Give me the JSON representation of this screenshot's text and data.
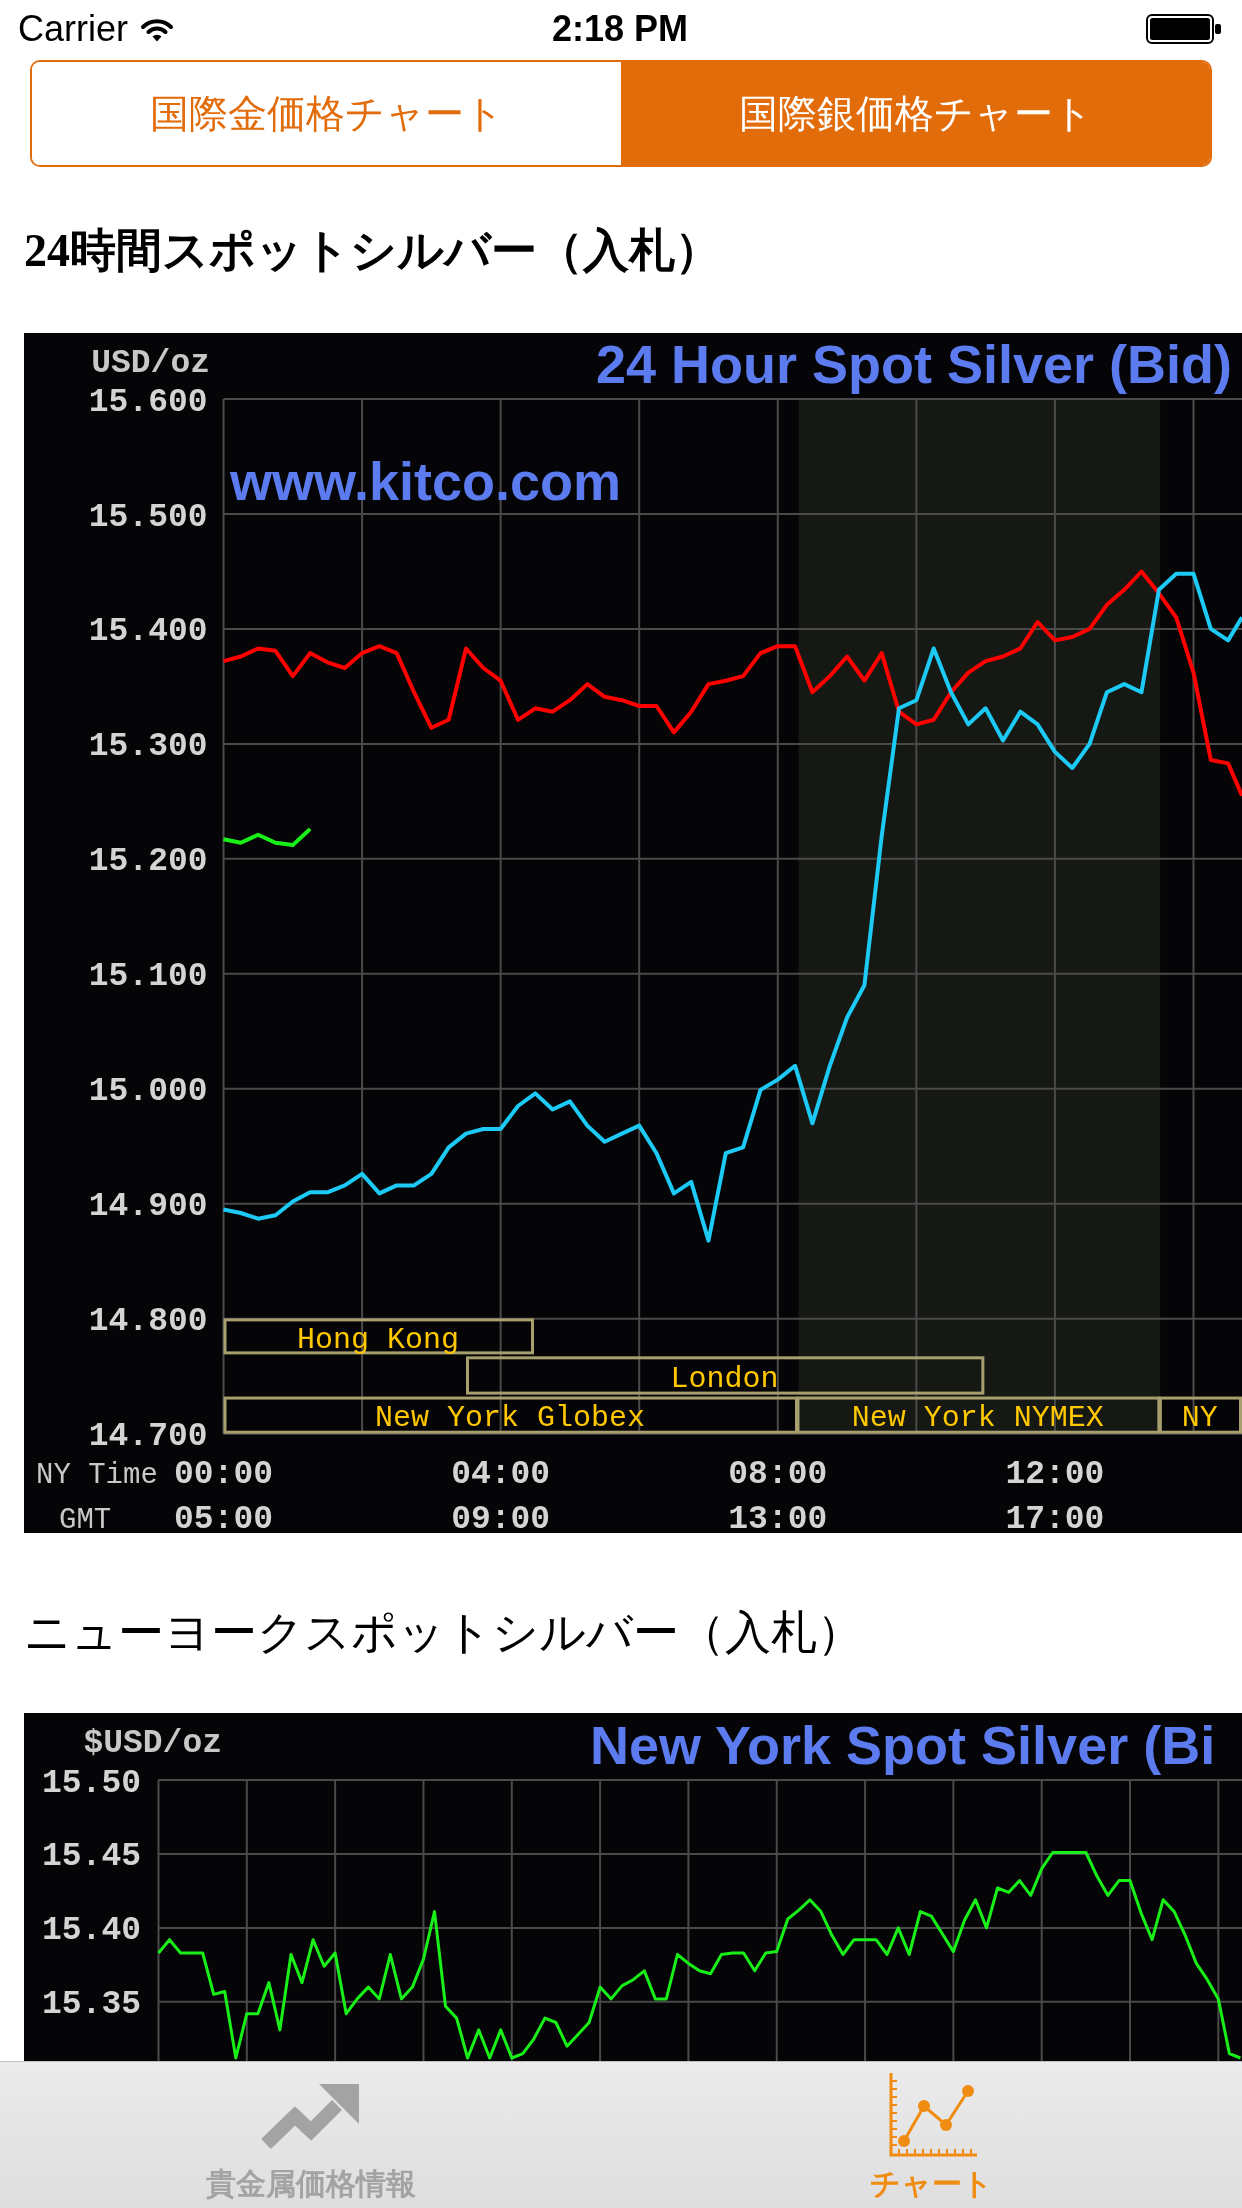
{
  "status_bar": {
    "carrier": "Carrier",
    "time": "2:18 PM"
  },
  "segmented_control": [
    {
      "label": "国際金価格チャート",
      "selected": false
    },
    {
      "label": "国際銀価格チャート",
      "selected": true
    }
  ],
  "sections": [
    {
      "heading": "24時間スポットシルバー（入札）",
      "chart": {
        "source": "www.kitco.com",
        "chart_data": {
          "type": "line",
          "title": "24 Hour Spot Silver (Bid)",
          "xlabel": "NY Time",
          "ylabel": "USD/oz",
          "x": [
            0,
            0.25,
            0.5,
            0.75,
            1,
            1.25,
            1.5,
            1.75,
            2,
            2.25,
            2.5,
            2.75,
            3,
            3.25,
            3.5,
            3.75,
            4,
            4.25,
            4.5,
            4.75,
            5,
            5.25,
            5.5,
            5.75,
            6,
            6.25,
            6.5,
            6.75,
            7,
            7.25,
            7.5,
            7.75,
            8,
            8.25,
            8.5,
            8.75,
            9,
            9.25,
            9.5,
            9.75,
            10,
            10.25,
            10.5,
            10.75,
            11,
            11.25,
            11.5,
            11.75,
            12,
            12.25,
            12.5,
            12.75,
            13,
            13.25,
            13.5,
            13.75,
            14,
            14.25,
            14.5,
            14.7
          ],
          "series": [
            {
              "color": "#ff0000",
              "values": [
                15.372,
                15.376,
                15.383,
                15.381,
                15.359,
                15.379,
                15.371,
                15.366,
                15.379,
                15.385,
                15.379,
                15.345,
                15.314,
                15.321,
                15.383,
                15.366,
                15.355,
                15.321,
                15.331,
                15.328,
                15.338,
                15.352,
                15.341,
                15.338,
                15.333,
                15.333,
                15.31,
                15.328,
                15.352,
                15.355,
                15.359,
                15.379,
                15.385,
                15.385,
                15.345,
                15.359,
                15.376,
                15.355,
                15.379,
                15.328,
                15.317,
                15.321,
                15.345,
                15.362,
                15.372,
                15.376,
                15.383,
                15.406,
                15.39,
                15.393,
                15.4,
                15.421,
                15.434,
                15.45,
                15.431,
                15.41,
                15.362,
                15.286,
                15.283,
                15.255
              ]
            },
            {
              "color": "#1ccaf5",
              "values": [
                14.895,
                14.892,
                14.887,
                14.89,
                14.902,
                14.91,
                14.91,
                14.916,
                14.926,
                14.909,
                14.916,
                14.916,
                14.926,
                14.949,
                14.961,
                14.965,
                14.965,
                14.985,
                14.996,
                14.982,
                14.989,
                14.968,
                14.954,
                14.961,
                14.968,
                14.944,
                14.909,
                14.919,
                14.868,
                14.944,
                14.949,
                14.999,
                15.008,
                15.02,
                14.97,
                15.02,
                15.062,
                15.09,
                15.22,
                15.331,
                15.338,
                15.383,
                15.345,
                15.317,
                15.331,
                15.303,
                15.328,
                15.317,
                15.293,
                15.279,
                15.3,
                15.345,
                15.352,
                15.345,
                15.434,
                15.448,
                15.448,
                15.4,
                15.39,
                15.41
              ]
            },
            {
              "color": "#18f018",
              "values": [
                15.217,
                15.214,
                15.221,
                15.214,
                15.212,
                15.226,
                null,
                null,
                null,
                null,
                null,
                null,
                null,
                null,
                null,
                null,
                null,
                null,
                null,
                null,
                null,
                null,
                null,
                null,
                null,
                null,
                null,
                null,
                null,
                null,
                null,
                null,
                null,
                null,
                null,
                null,
                null,
                null,
                null,
                null,
                null,
                null,
                null,
                null,
                null,
                null,
                null,
                null,
                null,
                null,
                null,
                null,
                null,
                null,
                null,
                null,
                null,
                null,
                null,
                null
              ]
            }
          ],
          "xlim": [
            0,
            14.7
          ],
          "ylim": [
            14.7,
            15.6
          ],
          "xticks": [
            {
              "value": 0,
              "label": "00:00"
            },
            {
              "value": 4,
              "label": "04:00"
            },
            {
              "value": 8,
              "label": "08:00"
            },
            {
              "value": 12,
              "label": "12:00"
            }
          ],
          "yticks": [
            {
              "value": 15.6,
              "label": "15.600"
            },
            {
              "value": 15.5,
              "label": "15.500"
            },
            {
              "value": 15.4,
              "label": "15.400"
            },
            {
              "value": 15.3,
              "label": "15.300"
            },
            {
              "value": 15.2,
              "label": "15.200"
            },
            {
              "value": 15.1,
              "label": "15.100"
            },
            {
              "value": 15,
              "label": "15.000"
            },
            {
              "value": 14.9,
              "label": "14.900"
            },
            {
              "value": 14.8,
              "label": "14.800"
            },
            {
              "value": 14.7,
              "label": "14.700"
            }
          ],
          "grid": true,
          "bands": [
            {
              "axis": "x",
              "from": 8.3,
              "to": 13.52
            }
          ]
        },
        "sessions": [
          "Hong Kong",
          "London",
          "New York Globex",
          "New York NYMEX",
          "NY"
        ],
        "gmt_axis": {
          "label": "GMT",
          "ticks": [
            "05:00",
            "09:00",
            "13:00",
            "17:00"
          ]
        }
      }
    },
    {
      "heading": "ニューヨークスポットシルバー（入札）",
      "chart": {
        "chart_data": {
          "type": "line",
          "title": "New York Spot Silver (Bi",
          "ylabel": "$USD/oz",
          "categories": [
            null,
            null,
            null,
            null,
            null,
            null,
            null,
            null,
            null,
            null,
            null,
            null,
            null,
            null,
            null,
            null,
            null,
            null,
            null,
            null,
            null,
            null,
            null,
            null,
            null,
            null,
            null,
            null,
            null,
            null,
            null,
            null,
            null,
            null,
            null,
            null,
            null,
            null,
            null,
            null,
            null,
            null,
            null,
            null,
            null,
            null,
            null,
            null,
            null,
            null,
            null,
            null,
            null,
            null,
            null,
            null,
            null,
            null,
            null,
            null,
            null,
            null,
            null,
            null,
            null,
            null,
            null,
            null,
            null,
            null,
            null,
            null,
            null,
            null,
            null,
            null,
            null,
            null,
            null,
            null,
            null,
            null,
            null,
            null,
            null,
            null,
            null,
            null,
            null,
            null,
            null,
            null,
            null,
            null,
            null,
            null,
            null,
            null,
            null
          ],
          "series": [
            {
              "color": "#18f018",
              "values": [
                15.383,
                15.392,
                15.383,
                15.383,
                15.383,
                15.355,
                15.357,
                15.312,
                15.342,
                15.342,
                15.363,
                15.331,
                15.382,
                15.363,
                15.392,
                15.374,
                15.383,
                15.342,
                15.352,
                15.36,
                15.352,
                15.382,
                15.352,
                15.36,
                15.379,
                15.411,
                15.347,
                15.339,
                15.312,
                15.331,
                15.312,
                15.331,
                15.312,
                15.315,
                15.325,
                15.339,
                15.336,
                15.32,
                15.328,
                15.336,
                15.36,
                15.352,
                15.361,
                15.365,
                15.371,
                15.352,
                15.352,
                15.382,
                15.376,
                15.371,
                15.369,
                15.382,
                15.383,
                15.383,
                15.371,
                15.383,
                15.384,
                15.406,
                15.412,
                15.419,
                15.411,
                15.395,
                15.382,
                15.392,
                15.392,
                15.392,
                15.382,
                15.4,
                15.382,
                15.411,
                15.408,
                15.396,
                15.384,
                15.405,
                15.419,
                15.4,
                15.427,
                15.424,
                15.432,
                15.422,
                15.44,
                15.451,
                15.451,
                15.451,
                15.451,
                15.435,
                15.422,
                15.432,
                15.432,
                15.41,
                15.392,
                15.419,
                15.411,
                15.395,
                15.376,
                15.365,
                15.352,
                15.315,
                15.312
              ]
            }
          ],
          "ylim": [
            15.31,
            15.5
          ],
          "yticks": [
            {
              "value": 15.5,
              "label": "15.50"
            },
            {
              "value": 15.45,
              "label": "15.45"
            },
            {
              "value": 15.4,
              "label": "15.40"
            },
            {
              "value": 15.35,
              "label": "15.35"
            }
          ],
          "grid": true
        }
      }
    }
  ],
  "tab_bar": [
    {
      "label": "貴金属価格情報",
      "selected": false
    },
    {
      "label": "チャート",
      "selected": true
    }
  ]
}
